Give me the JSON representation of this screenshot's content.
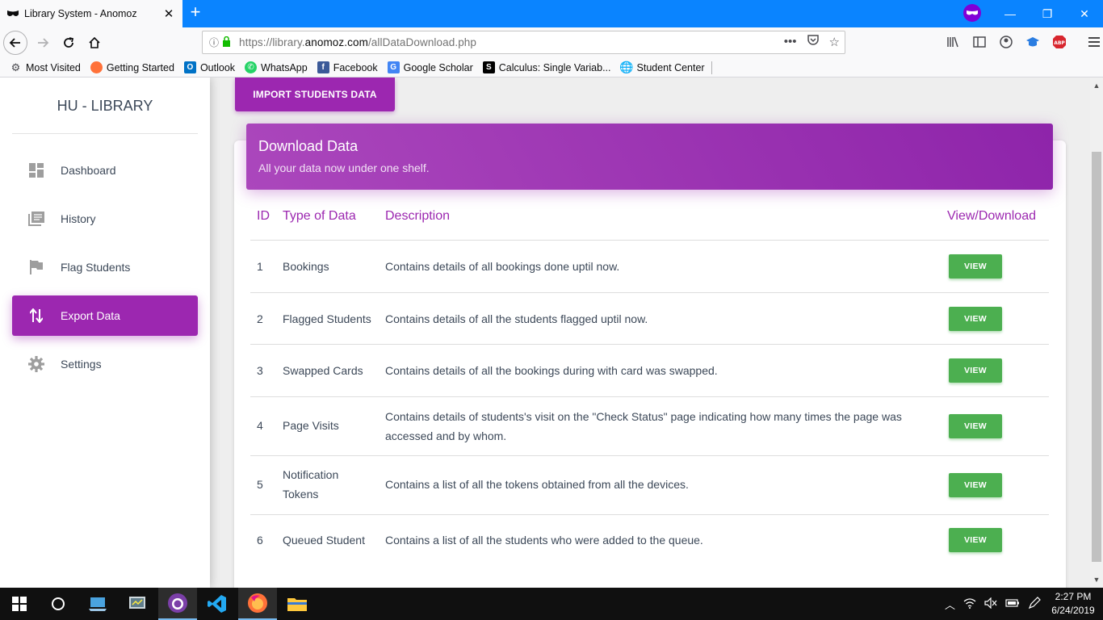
{
  "browser": {
    "tab_title": "Library System - Anomoz",
    "new_tab": "+",
    "url_prefix": "https://library.",
    "url_domain": "anomoz.com",
    "url_path": "/allDataDownload.php",
    "bookmarks": [
      "Most Visited",
      "Getting Started",
      "Outlook",
      "WhatsApp",
      "Facebook",
      "Google Scholar",
      "Calculus: Single Variab...",
      "Student Center"
    ]
  },
  "sidebar": {
    "brand": "HU - LIBRARY",
    "items": [
      {
        "label": "Dashboard",
        "icon": "dashboard-icon"
      },
      {
        "label": "History",
        "icon": "history-icon"
      },
      {
        "label": "Flag Students",
        "icon": "flag-icon"
      },
      {
        "label": "Export Data",
        "icon": "import-export-icon",
        "active": true
      },
      {
        "label": "Settings",
        "icon": "gear-icon"
      }
    ]
  },
  "main": {
    "import_button": "IMPORT STUDENTS DATA",
    "card_title": "Download Data",
    "card_subtitle": "All your data now under one shelf.",
    "columns": {
      "id": "ID",
      "type": "Type of Data",
      "description": "Description",
      "action": "View/Download"
    },
    "rows": [
      {
        "id": "1",
        "type": "Bookings",
        "description": "Contains details of all bookings done uptil now.",
        "action": "VIEW"
      },
      {
        "id": "2",
        "type": "Flagged Students",
        "description": "Contains details of all the students flagged uptil now.",
        "action": "VIEW"
      },
      {
        "id": "3",
        "type": "Swapped Cards",
        "description": "Contains details of all the bookings during with card was swapped.",
        "action": "VIEW"
      },
      {
        "id": "4",
        "type": "Page Visits",
        "description": "Contains details of students's visit on the \"Check Status\" page indicating how many times the page was accessed and by whom.",
        "action": "VIEW"
      },
      {
        "id": "5",
        "type": "Notification Tokens",
        "description": "Contains a list of all the tokens obtained from all the devices.",
        "action": "VIEW"
      },
      {
        "id": "6",
        "type": "Queued Student",
        "description": "Contains a list of all the students who were added to the queue.",
        "action": "VIEW"
      }
    ]
  },
  "taskbar": {
    "time": "2:27 PM",
    "date": "6/24/2019"
  },
  "colors": {
    "primary": "#9c27b0",
    "success": "#4caf50",
    "firefox_blue": "#0a84ff"
  }
}
